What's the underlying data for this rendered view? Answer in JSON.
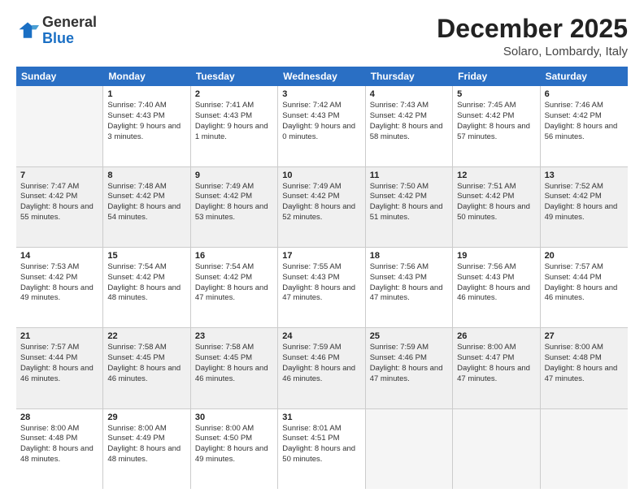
{
  "logo": {
    "general": "General",
    "blue": "Blue"
  },
  "header": {
    "month": "December 2025",
    "location": "Solaro, Lombardy, Italy"
  },
  "days": [
    "Sunday",
    "Monday",
    "Tuesday",
    "Wednesday",
    "Thursday",
    "Friday",
    "Saturday"
  ],
  "weeks": [
    [
      {
        "day": "",
        "sunrise": "",
        "sunset": "",
        "daylight": ""
      },
      {
        "day": "1",
        "sunrise": "Sunrise: 7:40 AM",
        "sunset": "Sunset: 4:43 PM",
        "daylight": "Daylight: 9 hours and 3 minutes."
      },
      {
        "day": "2",
        "sunrise": "Sunrise: 7:41 AM",
        "sunset": "Sunset: 4:43 PM",
        "daylight": "Daylight: 9 hours and 1 minute."
      },
      {
        "day": "3",
        "sunrise": "Sunrise: 7:42 AM",
        "sunset": "Sunset: 4:43 PM",
        "daylight": "Daylight: 9 hours and 0 minutes."
      },
      {
        "day": "4",
        "sunrise": "Sunrise: 7:43 AM",
        "sunset": "Sunset: 4:42 PM",
        "daylight": "Daylight: 8 hours and 58 minutes."
      },
      {
        "day": "5",
        "sunrise": "Sunrise: 7:45 AM",
        "sunset": "Sunset: 4:42 PM",
        "daylight": "Daylight: 8 hours and 57 minutes."
      },
      {
        "day": "6",
        "sunrise": "Sunrise: 7:46 AM",
        "sunset": "Sunset: 4:42 PM",
        "daylight": "Daylight: 8 hours and 56 minutes."
      }
    ],
    [
      {
        "day": "7",
        "sunrise": "Sunrise: 7:47 AM",
        "sunset": "Sunset: 4:42 PM",
        "daylight": "Daylight: 8 hours and 55 minutes."
      },
      {
        "day": "8",
        "sunrise": "Sunrise: 7:48 AM",
        "sunset": "Sunset: 4:42 PM",
        "daylight": "Daylight: 8 hours and 54 minutes."
      },
      {
        "day": "9",
        "sunrise": "Sunrise: 7:49 AM",
        "sunset": "Sunset: 4:42 PM",
        "daylight": "Daylight: 8 hours and 53 minutes."
      },
      {
        "day": "10",
        "sunrise": "Sunrise: 7:49 AM",
        "sunset": "Sunset: 4:42 PM",
        "daylight": "Daylight: 8 hours and 52 minutes."
      },
      {
        "day": "11",
        "sunrise": "Sunrise: 7:50 AM",
        "sunset": "Sunset: 4:42 PM",
        "daylight": "Daylight: 8 hours and 51 minutes."
      },
      {
        "day": "12",
        "sunrise": "Sunrise: 7:51 AM",
        "sunset": "Sunset: 4:42 PM",
        "daylight": "Daylight: 8 hours and 50 minutes."
      },
      {
        "day": "13",
        "sunrise": "Sunrise: 7:52 AM",
        "sunset": "Sunset: 4:42 PM",
        "daylight": "Daylight: 8 hours and 49 minutes."
      }
    ],
    [
      {
        "day": "14",
        "sunrise": "Sunrise: 7:53 AM",
        "sunset": "Sunset: 4:42 PM",
        "daylight": "Daylight: 8 hours and 49 minutes."
      },
      {
        "day": "15",
        "sunrise": "Sunrise: 7:54 AM",
        "sunset": "Sunset: 4:42 PM",
        "daylight": "Daylight: 8 hours and 48 minutes."
      },
      {
        "day": "16",
        "sunrise": "Sunrise: 7:54 AM",
        "sunset": "Sunset: 4:42 PM",
        "daylight": "Daylight: 8 hours and 47 minutes."
      },
      {
        "day": "17",
        "sunrise": "Sunrise: 7:55 AM",
        "sunset": "Sunset: 4:43 PM",
        "daylight": "Daylight: 8 hours and 47 minutes."
      },
      {
        "day": "18",
        "sunrise": "Sunrise: 7:56 AM",
        "sunset": "Sunset: 4:43 PM",
        "daylight": "Daylight: 8 hours and 47 minutes."
      },
      {
        "day": "19",
        "sunrise": "Sunrise: 7:56 AM",
        "sunset": "Sunset: 4:43 PM",
        "daylight": "Daylight: 8 hours and 46 minutes."
      },
      {
        "day": "20",
        "sunrise": "Sunrise: 7:57 AM",
        "sunset": "Sunset: 4:44 PM",
        "daylight": "Daylight: 8 hours and 46 minutes."
      }
    ],
    [
      {
        "day": "21",
        "sunrise": "Sunrise: 7:57 AM",
        "sunset": "Sunset: 4:44 PM",
        "daylight": "Daylight: 8 hours and 46 minutes."
      },
      {
        "day": "22",
        "sunrise": "Sunrise: 7:58 AM",
        "sunset": "Sunset: 4:45 PM",
        "daylight": "Daylight: 8 hours and 46 minutes."
      },
      {
        "day": "23",
        "sunrise": "Sunrise: 7:58 AM",
        "sunset": "Sunset: 4:45 PM",
        "daylight": "Daylight: 8 hours and 46 minutes."
      },
      {
        "day": "24",
        "sunrise": "Sunrise: 7:59 AM",
        "sunset": "Sunset: 4:46 PM",
        "daylight": "Daylight: 8 hours and 46 minutes."
      },
      {
        "day": "25",
        "sunrise": "Sunrise: 7:59 AM",
        "sunset": "Sunset: 4:46 PM",
        "daylight": "Daylight: 8 hours and 47 minutes."
      },
      {
        "day": "26",
        "sunrise": "Sunrise: 8:00 AM",
        "sunset": "Sunset: 4:47 PM",
        "daylight": "Daylight: 8 hours and 47 minutes."
      },
      {
        "day": "27",
        "sunrise": "Sunrise: 8:00 AM",
        "sunset": "Sunset: 4:48 PM",
        "daylight": "Daylight: 8 hours and 47 minutes."
      }
    ],
    [
      {
        "day": "28",
        "sunrise": "Sunrise: 8:00 AM",
        "sunset": "Sunset: 4:48 PM",
        "daylight": "Daylight: 8 hours and 48 minutes."
      },
      {
        "day": "29",
        "sunrise": "Sunrise: 8:00 AM",
        "sunset": "Sunset: 4:49 PM",
        "daylight": "Daylight: 8 hours and 48 minutes."
      },
      {
        "day": "30",
        "sunrise": "Sunrise: 8:00 AM",
        "sunset": "Sunset: 4:50 PM",
        "daylight": "Daylight: 8 hours and 49 minutes."
      },
      {
        "day": "31",
        "sunrise": "Sunrise: 8:01 AM",
        "sunset": "Sunset: 4:51 PM",
        "daylight": "Daylight: 8 hours and 50 minutes."
      },
      {
        "day": "",
        "sunrise": "",
        "sunset": "",
        "daylight": ""
      },
      {
        "day": "",
        "sunrise": "",
        "sunset": "",
        "daylight": ""
      },
      {
        "day": "",
        "sunrise": "",
        "sunset": "",
        "daylight": ""
      }
    ]
  ]
}
